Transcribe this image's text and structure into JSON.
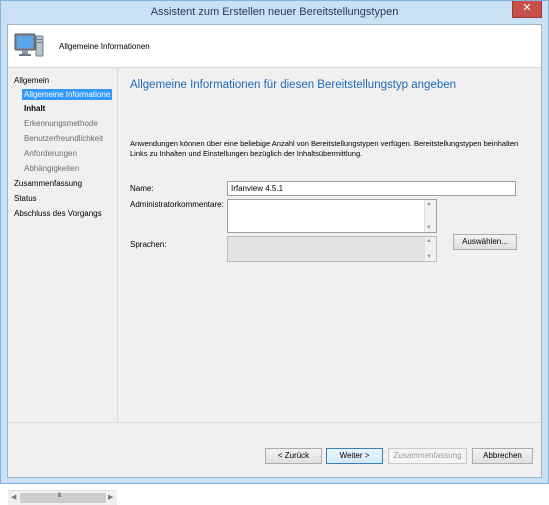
{
  "window": {
    "title": "Assistent zum Erstellen neuer Bereitstellungstypen",
    "close_glyph": "✕"
  },
  "header": {
    "title": "Allgemeine Informationen",
    "icon": "computer-monitor-icon"
  },
  "sidebar": {
    "items": [
      {
        "label": "Allgemein",
        "state": "normal"
      },
      {
        "label": "Allgemeine Informatione",
        "state": "selected"
      },
      {
        "label": "Inhalt",
        "state": "bold"
      },
      {
        "label": "Erkennungsmethode",
        "state": "dim"
      },
      {
        "label": "Benutzerfreundlichkeit",
        "state": "dim"
      },
      {
        "label": "Anforderungen",
        "state": "dim"
      },
      {
        "label": "Abhängigkeiten",
        "state": "dim"
      },
      {
        "label": "Zusammenfassung",
        "state": "normal"
      },
      {
        "label": "Status",
        "state": "normal"
      },
      {
        "label": "Abschluss des Vorgangs",
        "state": "normal"
      }
    ],
    "scroll_left": "◀",
    "scroll_right": "▶",
    "scroll_grip": "III"
  },
  "main": {
    "page_title": "Allgemeine Informationen für diesen Bereitstellungstyp angeben",
    "description": "Anwendungen können über eine beliebige Anzahl von Bereitstellungstypen verfügen. Bereitstellungstypen beinhalten Links zu Inhalten und Einstellungen bezüglich der Inhaltsübermittlung.",
    "name_label": "Name:",
    "name_value": "Irfanview 4.5.1",
    "comment_label": "Administratorkommentare:",
    "languages_label": "Sprachen:",
    "select_button": "Auswählen..."
  },
  "footer": {
    "back": "< Zurück",
    "next": "Weiter >",
    "summary": "Zusammenfassung",
    "cancel": "Abbrechen"
  },
  "colors": {
    "accent": "#1e6bb8",
    "selection": "#3399ff",
    "close": "#c7504a"
  }
}
